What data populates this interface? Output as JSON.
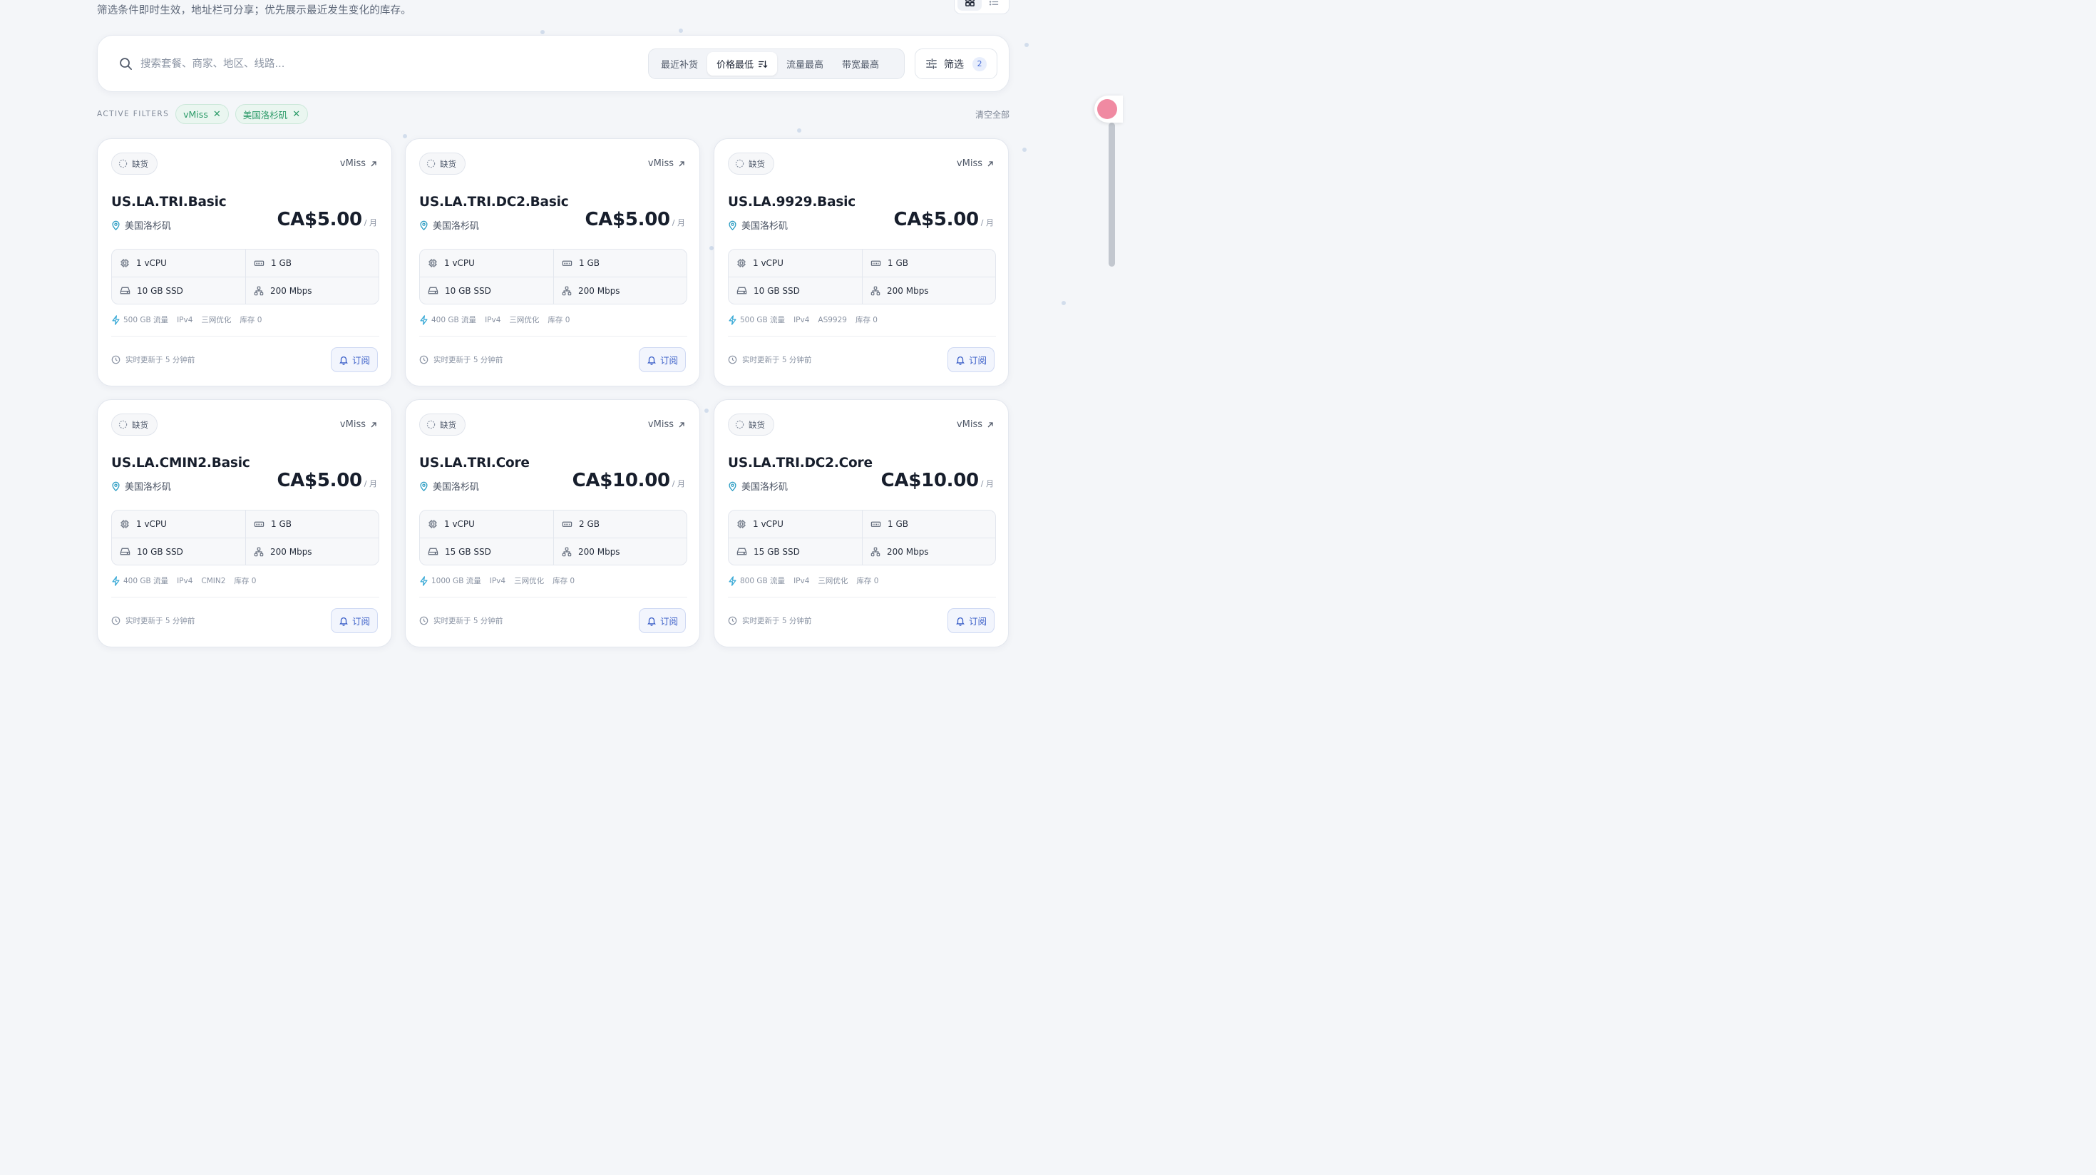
{
  "header": {
    "subtitle": "筛选条件即时生效，地址栏可分享；优先展示最近发生变化的库存。"
  },
  "search": {
    "placeholder": "搜索套餐、商家、地区、线路..."
  },
  "sort_options": [
    {
      "label": "最近补货",
      "active": false
    },
    {
      "label": "价格最低",
      "active": true
    },
    {
      "label": "流量最高",
      "active": false
    },
    {
      "label": "带宽最高",
      "active": false
    }
  ],
  "filter_button": {
    "label": "筛选",
    "count": "2"
  },
  "active_filters": {
    "label": "ACTIVE FILTERS",
    "chips": [
      "vMiss",
      "美国洛杉矶"
    ],
    "clear_all": "清空全部"
  },
  "colors": {
    "accent": "#3b5fc8",
    "chip_green": "#2a9a67",
    "location_icon": "#2f9ec4",
    "bolt_icon": "#38a9d6"
  },
  "cards": [
    {
      "status": "缺货",
      "merchant": "vMiss",
      "name": "US.LA.TRI.Basic",
      "location": "美国洛杉矶",
      "price": "CA$5.00",
      "unit": "/ 月",
      "cpu": "1 vCPU",
      "ram": "1 GB",
      "disk": "10 GB SSD",
      "bandwidth": "200 Mbps",
      "tags": [
        "500 GB 流量",
        "IPv4",
        "三网优化",
        "库存 0"
      ],
      "updated": "实时更新于 5 分钟前",
      "subscribe": "订阅"
    },
    {
      "status": "缺货",
      "merchant": "vMiss",
      "name": "US.LA.TRI.DC2.Basic",
      "location": "美国洛杉矶",
      "price": "CA$5.00",
      "unit": "/ 月",
      "cpu": "1 vCPU",
      "ram": "1 GB",
      "disk": "10 GB SSD",
      "bandwidth": "200 Mbps",
      "tags": [
        "400 GB 流量",
        "IPv4",
        "三网优化",
        "库存 0"
      ],
      "updated": "实时更新于 5 分钟前",
      "subscribe": "订阅"
    },
    {
      "status": "缺货",
      "merchant": "vMiss",
      "name": "US.LA.9929.Basic",
      "location": "美国洛杉矶",
      "price": "CA$5.00",
      "unit": "/ 月",
      "cpu": "1 vCPU",
      "ram": "1 GB",
      "disk": "10 GB SSD",
      "bandwidth": "200 Mbps",
      "tags": [
        "500 GB 流量",
        "IPv4",
        "AS9929",
        "库存 0"
      ],
      "updated": "实时更新于 5 分钟前",
      "subscribe": "订阅"
    },
    {
      "status": "缺货",
      "merchant": "vMiss",
      "name": "US.LA.CMIN2.Basic",
      "location": "美国洛杉矶",
      "price": "CA$5.00",
      "unit": "/ 月",
      "cpu": "1 vCPU",
      "ram": "1 GB",
      "disk": "10 GB SSD",
      "bandwidth": "200 Mbps",
      "tags": [
        "400 GB 流量",
        "IPv4",
        "CMIN2",
        "库存 0"
      ],
      "updated": "实时更新于 5 分钟前",
      "subscribe": "订阅"
    },
    {
      "status": "缺货",
      "merchant": "vMiss",
      "name": "US.LA.TRI.Core",
      "location": "美国洛杉矶",
      "price": "CA$10.00",
      "unit": "/ 月",
      "cpu": "1 vCPU",
      "ram": "2 GB",
      "disk": "15 GB SSD",
      "bandwidth": "200 Mbps",
      "tags": [
        "1000 GB 流量",
        "IPv4",
        "三网优化",
        "库存 0"
      ],
      "updated": "实时更新于 5 分钟前",
      "subscribe": "订阅"
    },
    {
      "status": "缺货",
      "merchant": "vMiss",
      "name": "US.LA.TRI.DC2.Core",
      "location": "美国洛杉矶",
      "price": "CA$10.00",
      "unit": "/ 月",
      "cpu": "1 vCPU",
      "ram": "1 GB",
      "disk": "15 GB SSD",
      "bandwidth": "200 Mbps",
      "tags": [
        "800 GB 流量",
        "IPv4",
        "三网优化",
        "库存 0"
      ],
      "updated": "实时更新于 5 分钟前",
      "subscribe": "订阅"
    }
  ]
}
